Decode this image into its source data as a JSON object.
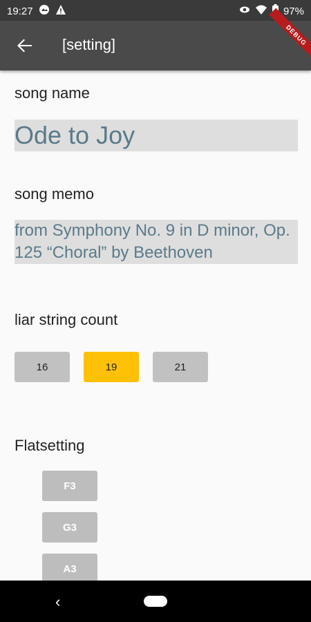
{
  "status": {
    "time": "19:27",
    "battery": "97%"
  },
  "appbar": {
    "title": "[setting]",
    "debug": "DEBUG"
  },
  "song": {
    "name_label": "song name",
    "name_value": "Ode to Joy",
    "memo_label": "song memo",
    "memo_value": "from Symphony No. 9 in D minor, Op. 125 “Choral” by Beethoven"
  },
  "strings": {
    "label": "liar string count",
    "options": [
      "16",
      "19",
      "21"
    ],
    "selected": "19"
  },
  "flat": {
    "label": "Flatsetting",
    "notes": [
      "F3",
      "G3",
      "A3"
    ]
  },
  "icons": [
    "back-arrow-icon",
    "gallery-icon",
    "warning-icon",
    "eye-icon",
    "wifi-icon",
    "battery-icon",
    "nav-back-icon",
    "nav-home-icon"
  ],
  "colors": {
    "appbar": "#4a4a4a",
    "selected": "#ffc107",
    "field_text": "#5b7a8a"
  }
}
